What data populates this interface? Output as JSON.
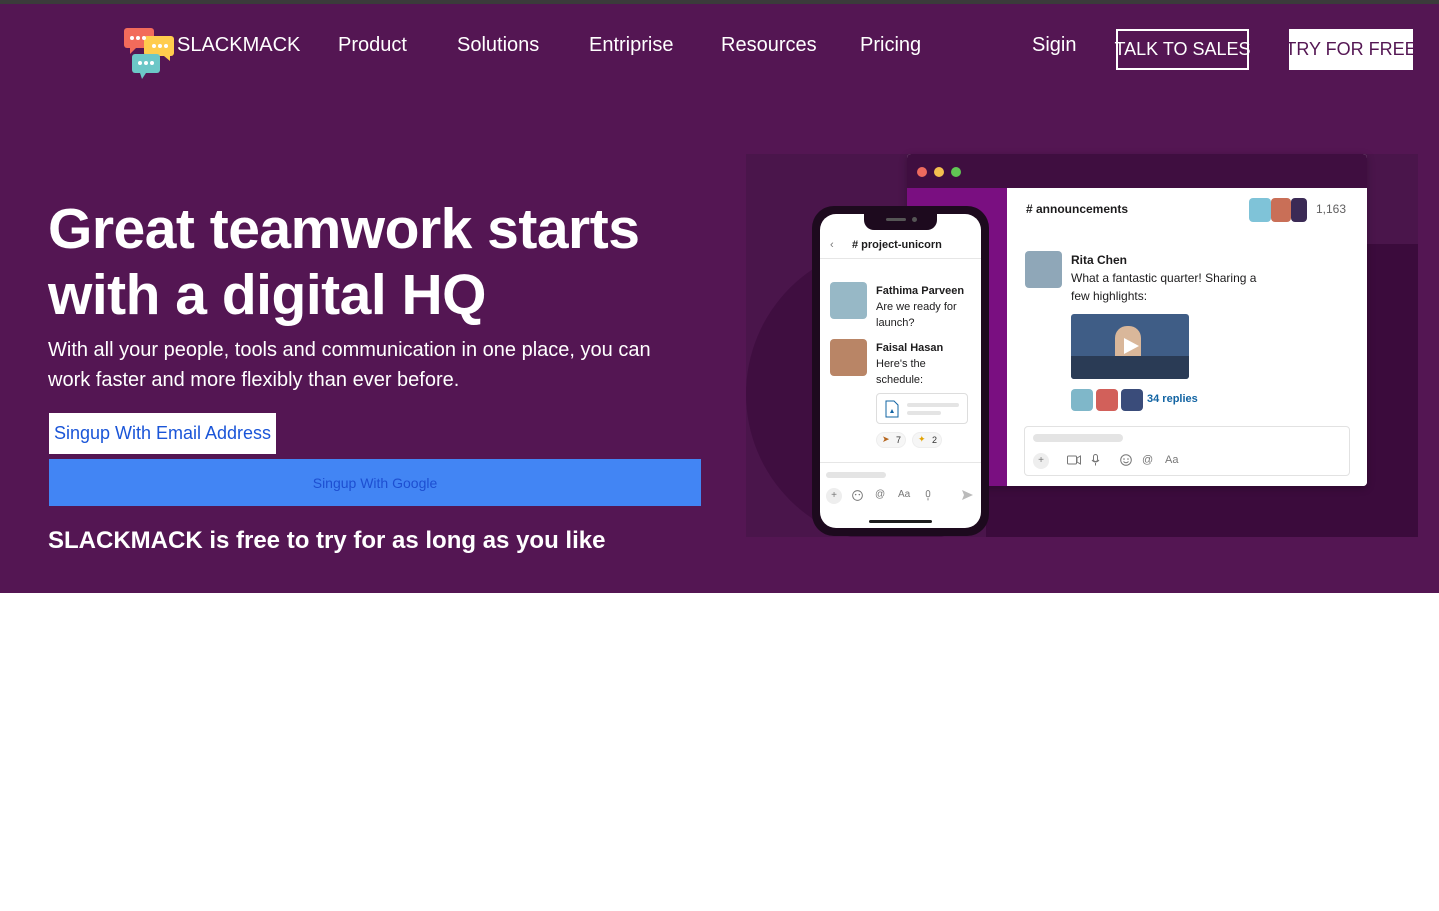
{
  "brand": {
    "name": "SLACKMACK",
    "logo_icon": "chat-bubbles-icon"
  },
  "nav": {
    "items": [
      {
        "label": "Product"
      },
      {
        "label": "Solutions"
      },
      {
        "label": "Entriprise"
      },
      {
        "label": "Resources"
      },
      {
        "label": "Pricing"
      }
    ],
    "signin": "Sigin",
    "talk_to_sales": "TALK TO SALES",
    "try_for_free": "TRY FOR FREE"
  },
  "hero": {
    "headline_line1": "Great teamwork starts",
    "headline_line2": "with a digital HQ",
    "subtext": "With all your people, tools and communication in one place, you can work faster and more flexibly than ever before.",
    "email_button": "Singup With Email Address",
    "google_button": "Singup With Google",
    "free_note": "SLACKMACK is free to try for as long as you like"
  },
  "illustration": {
    "desktop": {
      "channel": "# announcements",
      "member_count": "1,163",
      "author": "Rita Chen",
      "message_line1": "What a fantastic quarter! Sharing a",
      "message_line2": "few highlights:",
      "replies": "34 replies",
      "composer_icons": [
        "+",
        "video-icon",
        "mic-icon",
        "emoji-icon",
        "@",
        "Aa"
      ]
    },
    "phone": {
      "channel": "# project-unicorn",
      "msg1_author": "Fathima Parveen",
      "msg1_line1": "Are we ready for",
      "msg1_line2": "launch?",
      "msg2_author": "Faisal Hasan",
      "msg2_line1": "Here's the",
      "msg2_line2": "schedule:",
      "reaction1": "7",
      "reaction2": "2"
    }
  },
  "colors": {
    "hero_bg": "#541653",
    "google_blue": "#4285f4",
    "link_blue": "#1a55d8",
    "aubergine_dark": "#3f0e40",
    "sidebar_purple": "#7a0f81"
  }
}
